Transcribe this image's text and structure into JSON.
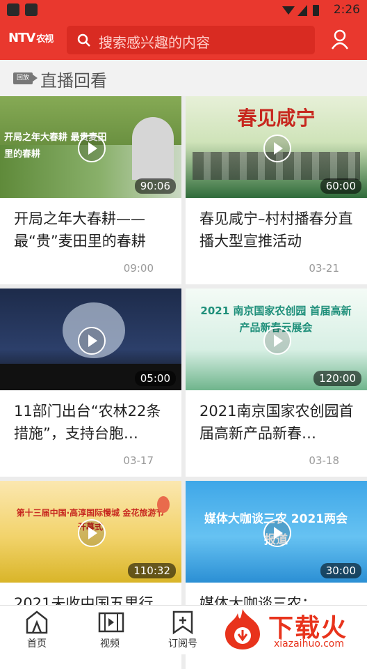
{
  "status": {
    "time": "2:26"
  },
  "header": {
    "logo": "NTV",
    "logo_sub": "农视",
    "search_placeholder": "搜索感兴趣的内容"
  },
  "section": {
    "badge": "回放",
    "title": "直播回看"
  },
  "cards": [
    {
      "title": "开局之年大春耕——最“贵”麦田里的春耕",
      "date": "09:00",
      "duration": "90:06",
      "thumb_text": "开局之年大春耕 最贵麦田里的春耕"
    },
    {
      "title": "春见咸宁–村村播春分直播大型宣推活动",
      "date": "03-21",
      "duration": "60:00",
      "thumb_text": "春见咸宁"
    },
    {
      "title": "11部门出台“农林22条措施”，支持台胞…",
      "date": "03-17",
      "duration": "05:00",
      "thumb_text": ""
    },
    {
      "title": "2021南京国家农创园首届高新产品新春…",
      "date": "03-18",
      "duration": "120:00",
      "thumb_text": "2021 南京国家农创园 首届高新产品新春云展会"
    },
    {
      "title": "2021未收中国五里行",
      "date": "",
      "duration": "110:32",
      "thumb_text": "第十三届中国·高淳国际慢城 金花旅游节开幕式"
    },
    {
      "title": "媒体大咖谈三农：",
      "date": "",
      "duration": "30:00",
      "thumb_text": "媒体大咖谈三农 2021两会报道"
    }
  ],
  "tabs": [
    {
      "label": "首页",
      "icon": "home-icon"
    },
    {
      "label": "视频",
      "icon": "video-icon"
    },
    {
      "label": "订阅号",
      "icon": "subscribe-icon"
    }
  ],
  "watermark": {
    "text": "下载火",
    "url": "xiazaihuo.com"
  }
}
